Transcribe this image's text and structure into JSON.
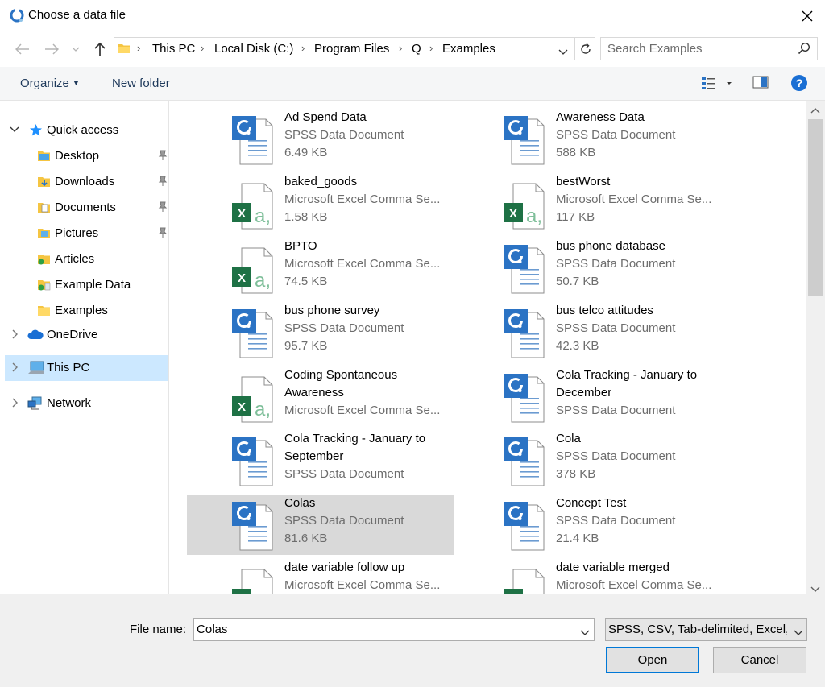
{
  "window": {
    "title": "Choose a data file"
  },
  "address": {
    "crumbs": [
      "This PC",
      "Local Disk (C:)",
      "Program Files",
      "Q",
      "Examples"
    ]
  },
  "search": {
    "placeholder": "Search Examples"
  },
  "toolbar": {
    "organize": "Organize",
    "new_folder": "New folder"
  },
  "sidebar": {
    "items": [
      {
        "label": "Quick access",
        "icon": "star-icon"
      },
      {
        "label": "Desktop",
        "icon": "folder-icon",
        "pinned": true
      },
      {
        "label": "Downloads",
        "icon": "folder-icon",
        "pinned": true
      },
      {
        "label": "Documents",
        "icon": "folder-icon",
        "pinned": true
      },
      {
        "label": "Pictures",
        "icon": "folder-icon",
        "pinned": true
      },
      {
        "label": "Articles",
        "icon": "folder-icon"
      },
      {
        "label": "Example Data",
        "icon": "folder-icon"
      },
      {
        "label": "Examples",
        "icon": "folder-icon"
      },
      {
        "label": "OneDrive",
        "icon": "cloud-icon"
      },
      {
        "label": "This PC",
        "icon": "computer-icon",
        "selected": true
      },
      {
        "label": "Network",
        "icon": "network-icon"
      }
    ]
  },
  "files": [
    {
      "name": "Ad Spend Data",
      "type": "SPSS Data Document",
      "size": "6.49 KB",
      "kind": "spss"
    },
    {
      "name": "Awareness Data",
      "type": "SPSS Data Document",
      "size": "588 KB",
      "kind": "spss"
    },
    {
      "name": "baked_goods",
      "type": "Microsoft Excel Comma Se...",
      "size": "1.58 KB",
      "kind": "csv"
    },
    {
      "name": "bestWorst",
      "type": "Microsoft Excel Comma Se...",
      "size": "117 KB",
      "kind": "csv"
    },
    {
      "name": "BPTO",
      "type": "Microsoft Excel Comma Se...",
      "size": "74.5 KB",
      "kind": "csv"
    },
    {
      "name": "bus phone database",
      "type": "SPSS Data Document",
      "size": "50.7 KB",
      "kind": "spss"
    },
    {
      "name": "bus phone survey",
      "type": "SPSS Data Document",
      "size": "95.7 KB",
      "kind": "spss"
    },
    {
      "name": "bus telco attitudes",
      "type": "SPSS Data Document",
      "size": "42.3 KB",
      "kind": "spss"
    },
    {
      "name": "Coding Spontaneous Awareness",
      "type": "Microsoft Excel Comma Se...",
      "size": "",
      "kind": "csv"
    },
    {
      "name": "Cola Tracking - January to December",
      "type": "SPSS Data Document",
      "size": "",
      "kind": "spss"
    },
    {
      "name": "Cola Tracking - January to September",
      "type": "SPSS Data Document",
      "size": "",
      "kind": "spss"
    },
    {
      "name": "Cola",
      "type": "SPSS Data Document",
      "size": "378 KB",
      "kind": "spss"
    },
    {
      "name": "Colas",
      "type": "SPSS Data Document",
      "size": "81.6 KB",
      "kind": "spss",
      "selected": true
    },
    {
      "name": "Concept Test",
      "type": "SPSS Data Document",
      "size": "21.4 KB",
      "kind": "spss"
    },
    {
      "name": "date variable follow up",
      "type": "Microsoft Excel Comma Se...",
      "size": "",
      "kind": "csv"
    },
    {
      "name": "date variable merged",
      "type": "Microsoft Excel Comma Se...",
      "size": "",
      "kind": "csv"
    }
  ],
  "bottom": {
    "file_name_label": "File name:",
    "file_name_value": "Colas",
    "filter_value": "SPSS, CSV, Tab-delimited, Excel,",
    "open_label": "Open",
    "cancel_label": "Cancel"
  },
  "colors": {
    "accent": "#0078d7",
    "selection": "#cce8ff",
    "spss_blue": "#2b73c4",
    "excel_green": "#1e7145"
  }
}
